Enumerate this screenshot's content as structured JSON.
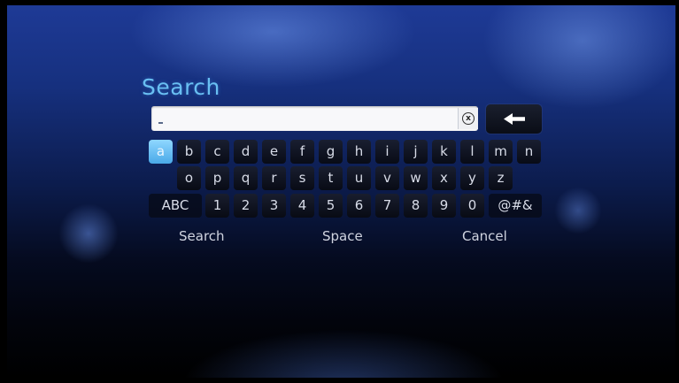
{
  "title": "Search",
  "search": {
    "value": ""
  },
  "keyboard": {
    "row1": [
      "a",
      "b",
      "c",
      "d",
      "e",
      "f",
      "g",
      "h",
      "i",
      "j",
      "k",
      "l",
      "m",
      "n"
    ],
    "row2": [
      "o",
      "p",
      "q",
      "r",
      "s",
      "t",
      "u",
      "v",
      "w",
      "x",
      "y",
      "z"
    ],
    "row3": {
      "abc": "ABC",
      "digits": [
        "1",
        "2",
        "3",
        "4",
        "5",
        "6",
        "7",
        "8",
        "9",
        "0"
      ],
      "symbols": "@#&"
    },
    "selected": "a"
  },
  "actions": {
    "search": "Search",
    "space": "Space",
    "cancel": "Cancel"
  },
  "icons": {
    "clear": "clear-x-icon",
    "backspace": "backspace-arrow-icon"
  },
  "colors": {
    "accent": "#69bff2",
    "key_selected": "#4aa9e8"
  }
}
